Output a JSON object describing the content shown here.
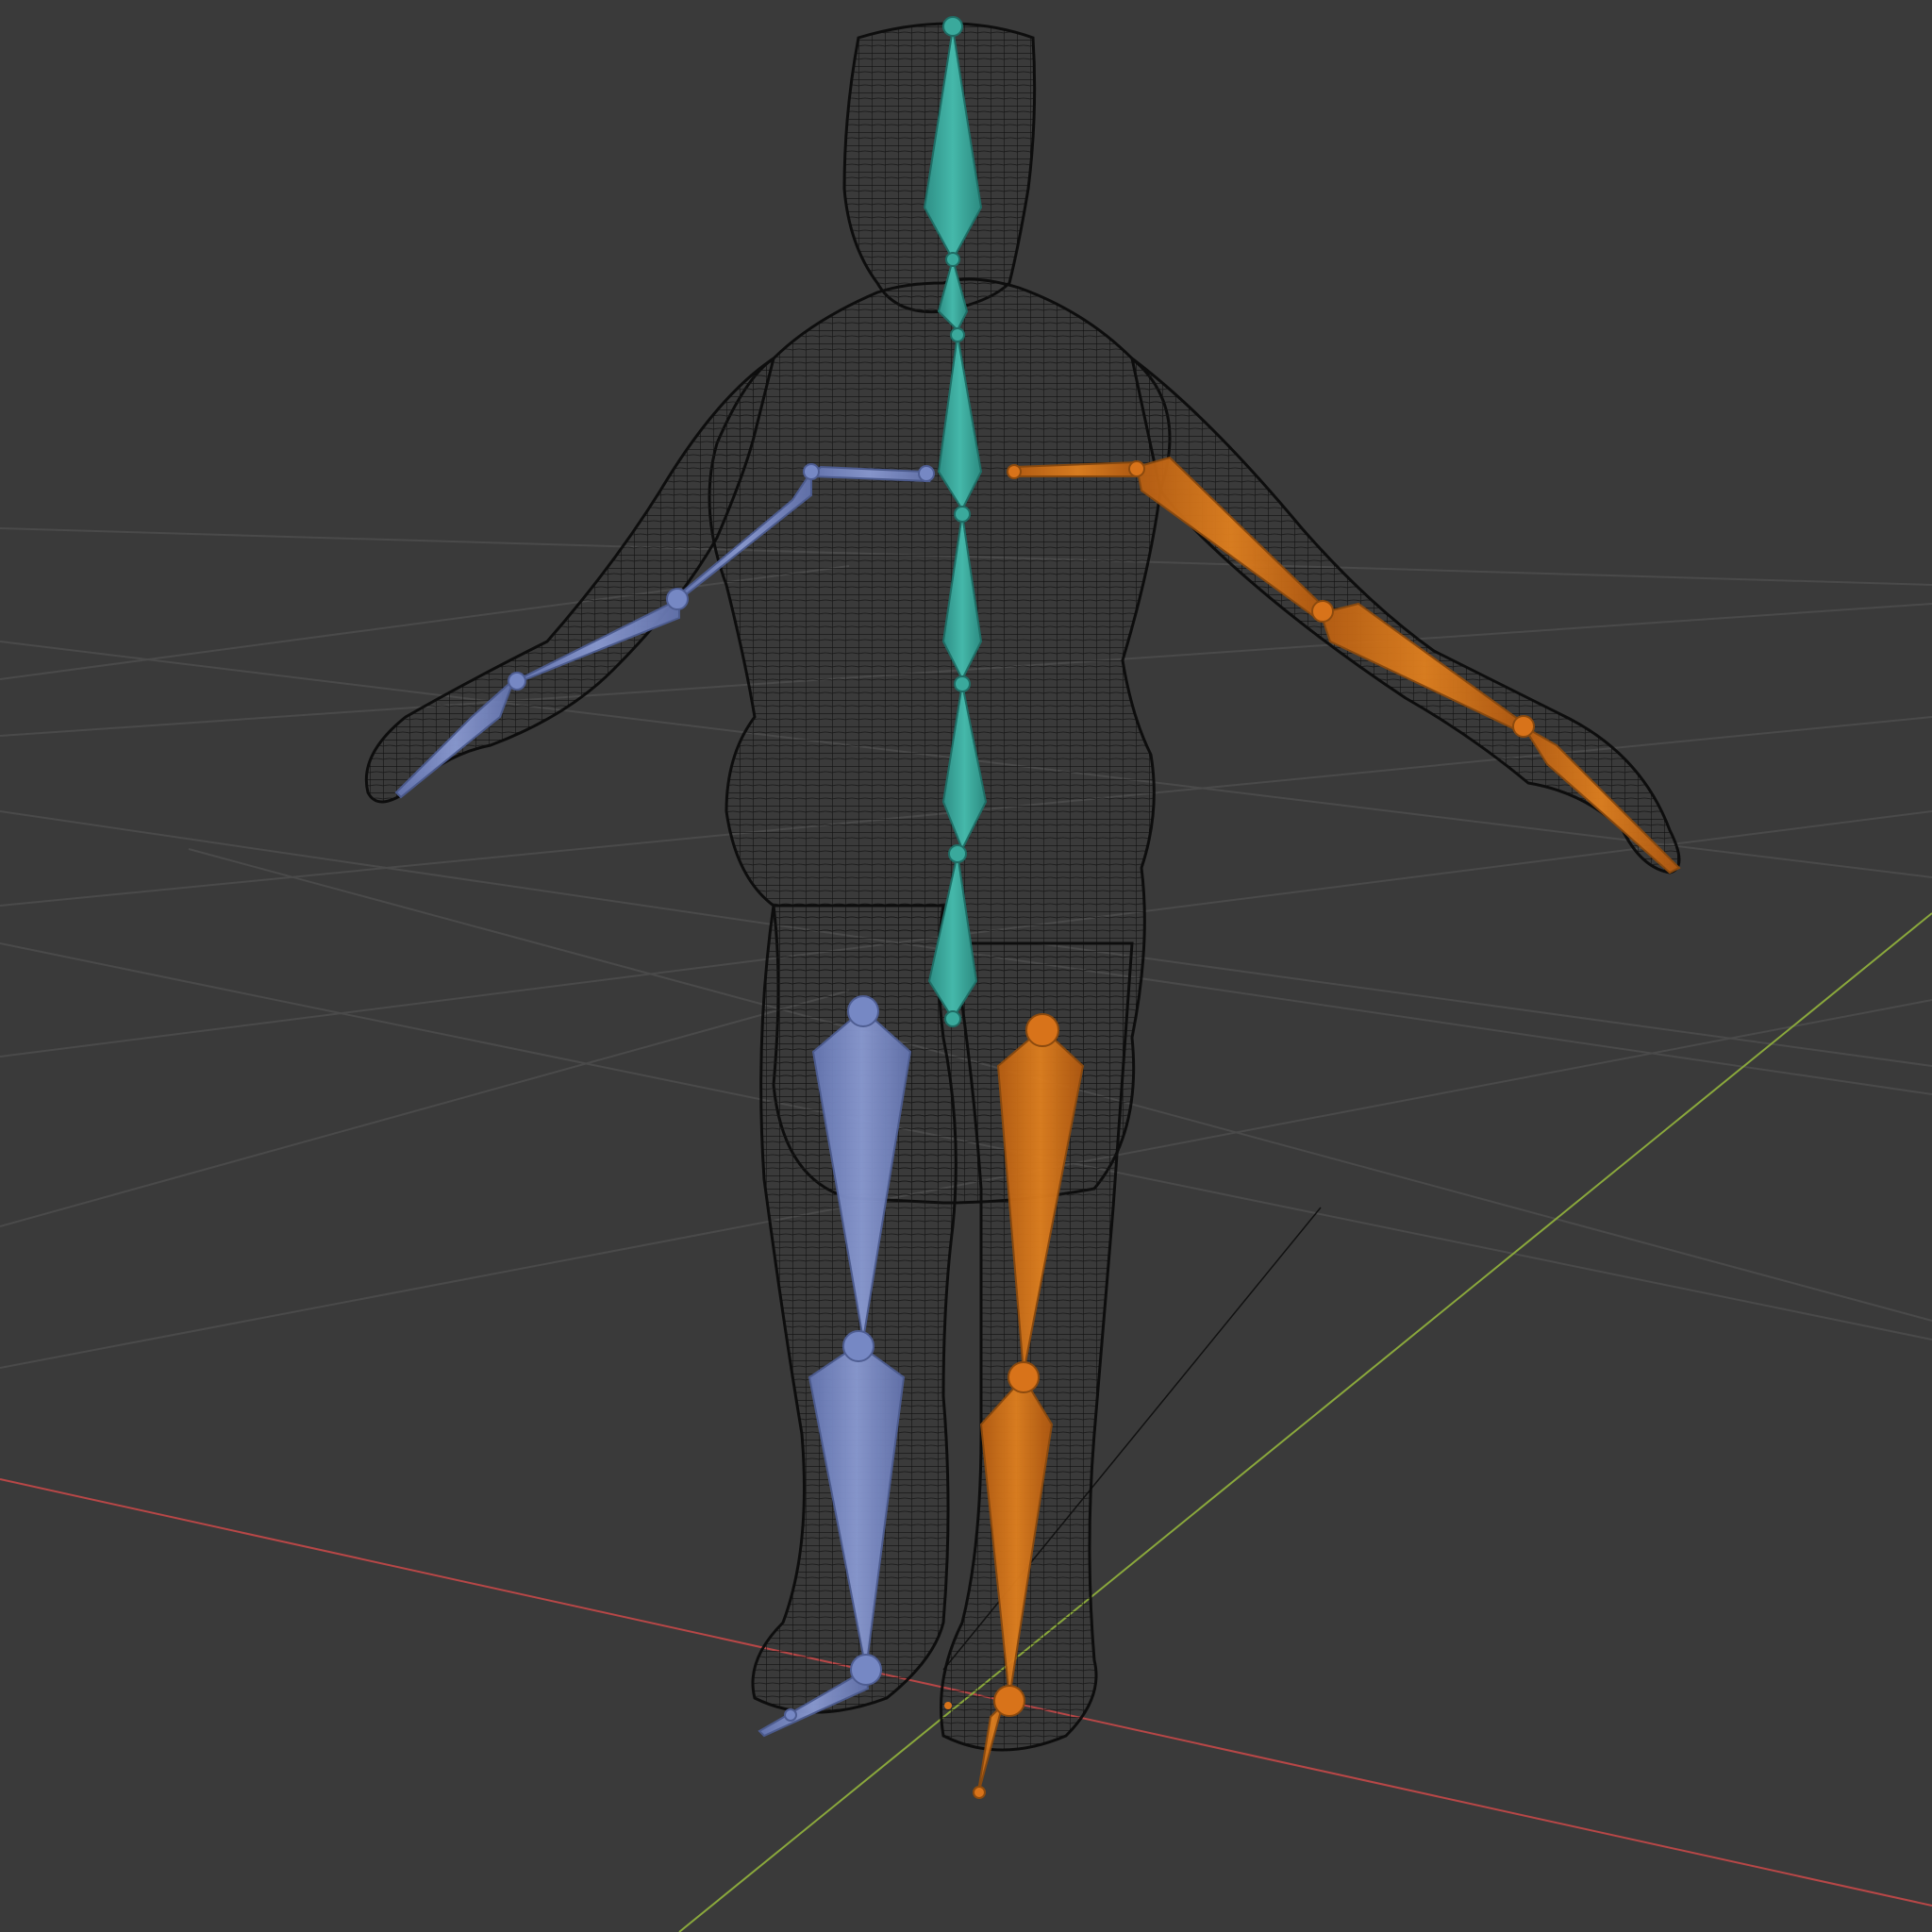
{
  "viewport": {
    "background": "#3a3a3a",
    "grid_color": "#4a4a4a",
    "x_axis_color": "#b84747",
    "y_axis_color": "#8aa83c",
    "wire_color": "#111111"
  },
  "armature": {
    "spine_color": "#3aa99c",
    "left_side_color": "#7688c4",
    "right_side_color": "#d8731a"
  }
}
